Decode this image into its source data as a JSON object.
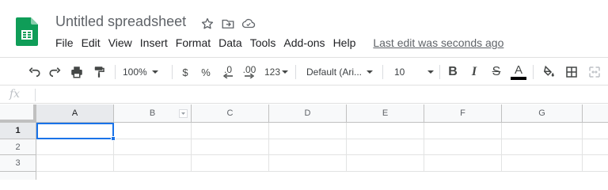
{
  "doc": {
    "title": "Untitled spreadsheet"
  },
  "menu": [
    "File",
    "Edit",
    "View",
    "Insert",
    "Format",
    "Data",
    "Tools",
    "Add-ons",
    "Help"
  ],
  "last_edit": "Last edit was seconds ago",
  "toolbar": {
    "zoom": "100%",
    "currency": "$",
    "percent": "%",
    "decimal_decrease": ".0",
    "decimal_increase": ".00",
    "more_formats": "123",
    "font": "Default (Ari...",
    "font_size": "10",
    "bold": "B",
    "italic": "I",
    "strike": "S",
    "text_color_letter": "A"
  },
  "formula_bar": {
    "fx": "fx",
    "value": ""
  },
  "columns": [
    "A",
    "B",
    "C",
    "D",
    "E",
    "F",
    "G"
  ],
  "rows": [
    "1",
    "2",
    "3"
  ],
  "selection": {
    "cell": "A1"
  },
  "colors": {
    "brand": "#0f9d58",
    "accent": "#1a73e8",
    "text_color_bar": "#000000"
  }
}
